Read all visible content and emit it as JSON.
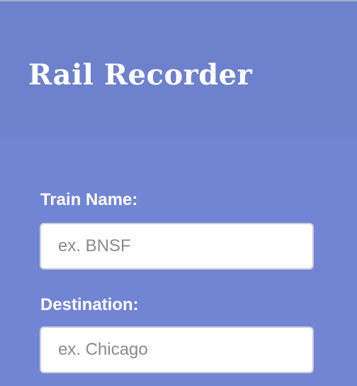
{
  "header": {
    "title": "Rail Recorder"
  },
  "form": {
    "train_name": {
      "label": "Train Name:",
      "value": "",
      "placeholder": "ex. BNSF"
    },
    "destination": {
      "label": "Destination:",
      "value": "",
      "placeholder": "ex. Chicago"
    }
  },
  "colors": {
    "header_background": "#6e81cc",
    "page_background": "#7284d4",
    "text": "#ffffff",
    "input_background": "#ffffff",
    "placeholder": "#8a8a8a"
  }
}
